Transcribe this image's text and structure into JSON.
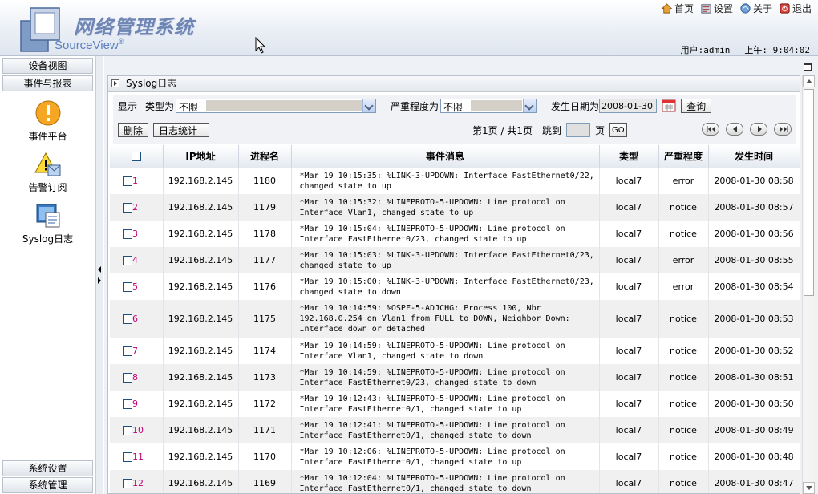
{
  "header": {
    "logo_cn": "网络管理系统",
    "logo_en": "SourceView",
    "logo_reg": "®",
    "links": [
      {
        "label": "首页",
        "icon": "home-icon"
      },
      {
        "label": "设置",
        "icon": "settings-icon"
      },
      {
        "label": "关于",
        "icon": "about-icon"
      },
      {
        "label": "退出",
        "icon": "logout-icon"
      }
    ],
    "user": "用户:admin",
    "time": "上午: 9:04:02"
  },
  "sidebar": {
    "sections_top": [
      "设备视图",
      "事件与报表"
    ],
    "items": [
      {
        "label": "事件平台",
        "icon": "warning-icon"
      },
      {
        "label": "告警订阅",
        "icon": "alarm-subscribe-icon"
      },
      {
        "label": "Syslog日志",
        "icon": "syslog-icon"
      }
    ],
    "sections_bottom": [
      "系统设置",
      "系统管理"
    ]
  },
  "panel": {
    "title": "Syslog日志",
    "filters": {
      "display_label": "显示",
      "type_label": "类型为",
      "type_value": "不限",
      "severity_label": "严重程度为",
      "severity_value": "不限",
      "date_label": "发生日期为",
      "date_value": "2008-01-30",
      "query_button": "查询"
    },
    "actions": {
      "delete_button": "删除",
      "stats_button": "日志统计"
    },
    "paging": {
      "page_info": "第1页 / 共1页",
      "jump_label": "跳到",
      "page_suffix": "页",
      "go_button": "GO"
    },
    "table": {
      "columns": [
        "IP地址",
        "进程名",
        "事件消息",
        "类型",
        "严重程度",
        "发生时间"
      ],
      "rows": [
        {
          "idx": "1",
          "ip": "192.168.2.145",
          "pid": "1180",
          "msg": "*Mar 19 10:15:35: %LINK-3-UPDOWN: Interface FastEthernet0/22,\nchanged state to up",
          "type": "local7",
          "sev": "error",
          "time": "2008-01-30 08:58"
        },
        {
          "idx": "2",
          "ip": "192.168.2.145",
          "pid": "1179",
          "msg": "*Mar 19 10:15:32: %LINEPROTO-5-UPDOWN: Line protocol on\nInterface Vlan1, changed state to up",
          "type": "local7",
          "sev": "notice",
          "time": "2008-01-30 08:57"
        },
        {
          "idx": "3",
          "ip": "192.168.2.145",
          "pid": "1178",
          "msg": "*Mar 19 10:15:04: %LINEPROTO-5-UPDOWN: Line protocol on\nInterface FastEthernet0/23, changed state to up",
          "type": "local7",
          "sev": "notice",
          "time": "2008-01-30 08:56"
        },
        {
          "idx": "4",
          "ip": "192.168.2.145",
          "pid": "1177",
          "msg": "*Mar 19 10:15:03: %LINK-3-UPDOWN: Interface FastEthernet0/23,\nchanged state to up",
          "type": "local7",
          "sev": "error",
          "time": "2008-01-30 08:55"
        },
        {
          "idx": "5",
          "ip": "192.168.2.145",
          "pid": "1176",
          "msg": "*Mar 19 10:15:00: %LINK-3-UPDOWN: Interface FastEthernet0/23,\nchanged state to down",
          "type": "local7",
          "sev": "error",
          "time": "2008-01-30 08:54"
        },
        {
          "idx": "6",
          "ip": "192.168.2.145",
          "pid": "1175",
          "msg": "*Mar 19 10:14:59: %OSPF-5-ADJCHG: Process 100, Nbr\n192.168.0.254 on Vlan1 from FULL to DOWN, Neighbor Down:\nInterface down or detached",
          "type": "local7",
          "sev": "notice",
          "time": "2008-01-30 08:53"
        },
        {
          "idx": "7",
          "ip": "192.168.2.145",
          "pid": "1174",
          "msg": "*Mar 19 10:14:59: %LINEPROTO-5-UPDOWN: Line protocol on\nInterface Vlan1, changed state to down",
          "type": "local7",
          "sev": "notice",
          "time": "2008-01-30 08:52"
        },
        {
          "idx": "8",
          "ip": "192.168.2.145",
          "pid": "1173",
          "msg": "*Mar 19 10:14:59: %LINEPROTO-5-UPDOWN: Line protocol on\nInterface FastEthernet0/23, changed state to down",
          "type": "local7",
          "sev": "notice",
          "time": "2008-01-30 08:51"
        },
        {
          "idx": "9",
          "ip": "192.168.2.145",
          "pid": "1172",
          "msg": "*Mar 19 10:12:43: %LINEPROTO-5-UPDOWN: Line protocol on\nInterface FastEthernet0/1, changed state to up",
          "type": "local7",
          "sev": "notice",
          "time": "2008-01-30 08:50"
        },
        {
          "idx": "10",
          "ip": "192.168.2.145",
          "pid": "1171",
          "msg": "*Mar 19 10:12:41: %LINEPROTO-5-UPDOWN: Line protocol on\nInterface FastEthernet0/1, changed state to down",
          "type": "local7",
          "sev": "notice",
          "time": "2008-01-30 08:49"
        },
        {
          "idx": "11",
          "ip": "192.168.2.145",
          "pid": "1170",
          "msg": "*Mar 19 10:12:06: %LINEPROTO-5-UPDOWN: Line protocol on\nInterface FastEthernet0/1, changed state to up",
          "type": "local7",
          "sev": "notice",
          "time": "2008-01-30 08:48"
        },
        {
          "idx": "12",
          "ip": "192.168.2.145",
          "pid": "1169",
          "msg": "*Mar 19 10:12:04: %LINEPROTO-5-UPDOWN: Line protocol on\nInterface FastEthernet0/1, changed state to down",
          "type": "local7",
          "sev": "notice",
          "time": "2008-01-30 08:47"
        }
      ]
    }
  },
  "colors": {
    "index_link": "#c00077",
    "logo": "#6f86b4",
    "accent": "#5c7fbf"
  }
}
